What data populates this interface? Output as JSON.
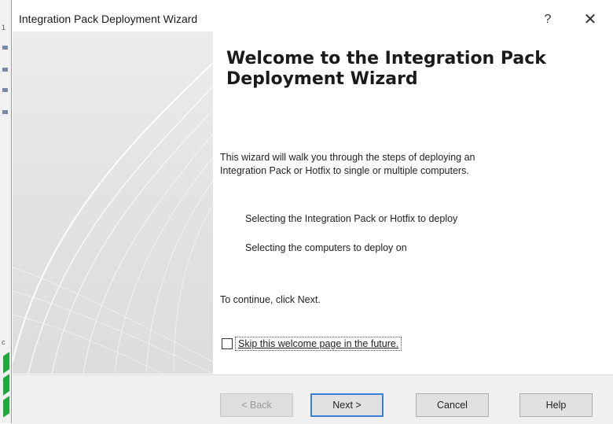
{
  "window": {
    "title": "Integration Pack Deployment Wizard",
    "help_icon": "?",
    "close_icon": "✕"
  },
  "content": {
    "heading_line1": "Welcome to the Integration Pack",
    "heading_line2": "Deployment Wizard",
    "intro_line1": "This wizard will walk you through the steps of deploying an",
    "intro_line2": "Integration Pack or Hotfix to single or multiple computers.",
    "steps": [
      "Selecting the Integration Pack or Hotfix to deploy",
      "Selecting the computers to deploy on"
    ],
    "continue_text": "To continue, click Next.",
    "skip_label": "Skip this welcome page in the future.",
    "skip_checked": false
  },
  "buttons": {
    "back": "< Back",
    "next": "Next >",
    "cancel": "Cancel",
    "help": "Help"
  },
  "colors": {
    "accent_border": "#3c7fd6",
    "footer_bg": "#f0f0f0",
    "side_panel": "#e3e3e3"
  }
}
